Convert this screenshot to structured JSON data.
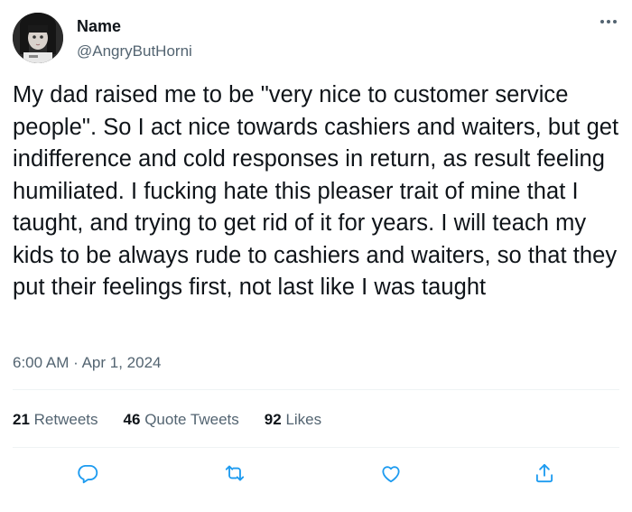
{
  "user": {
    "display_name": "Name",
    "handle": "@AngryButHorni",
    "avatar_icon": "profile-photo"
  },
  "tweet": {
    "text": "My dad raised me to be \"very nice to customer service people\". So I act nice towards cashiers and waiters, but get indifference and cold responses in return, as result feeling humiliated. I fucking hate this pleaser trait of mine that I taught, and trying to get rid of it for years. I will teach my kids to be always rude to cashiers and waiters, so that they put their feelings first, not last like I was taught",
    "time": "6:00 AM",
    "separator": "·",
    "date": "Apr 1, 2024"
  },
  "stats": {
    "retweets_count": "21",
    "retweets_label": "Retweets",
    "quotes_count": "46",
    "quotes_label": "Quote Tweets",
    "likes_count": "92",
    "likes_label": "Likes"
  },
  "actions": [
    "reply-icon",
    "retweet-icon",
    "like-icon",
    "share-icon"
  ],
  "colors": {
    "text_primary": "#0f1419",
    "text_secondary": "#536471",
    "divider": "#eff3f4",
    "action_icon": "#1d9bf0"
  }
}
